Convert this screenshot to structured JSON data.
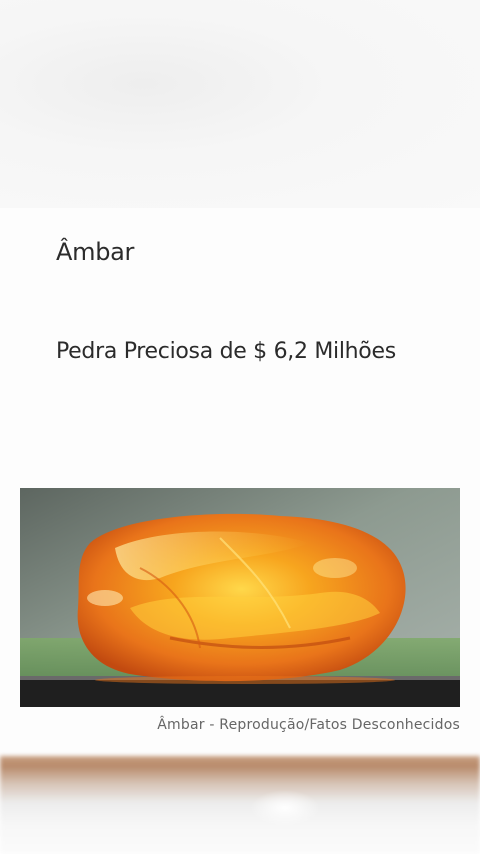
{
  "article": {
    "title": "Âmbar",
    "subtitle": "Pedra Preciosa de $ 6,2 Milhões",
    "image_caption": "Âmbar - Reprodução/Fatos Desconhecidos"
  },
  "colors": {
    "text": "#2b2b2b",
    "caption": "#666666",
    "amber": "#f08a1c"
  },
  "image": {
    "subject": "amber-stone-photo"
  }
}
